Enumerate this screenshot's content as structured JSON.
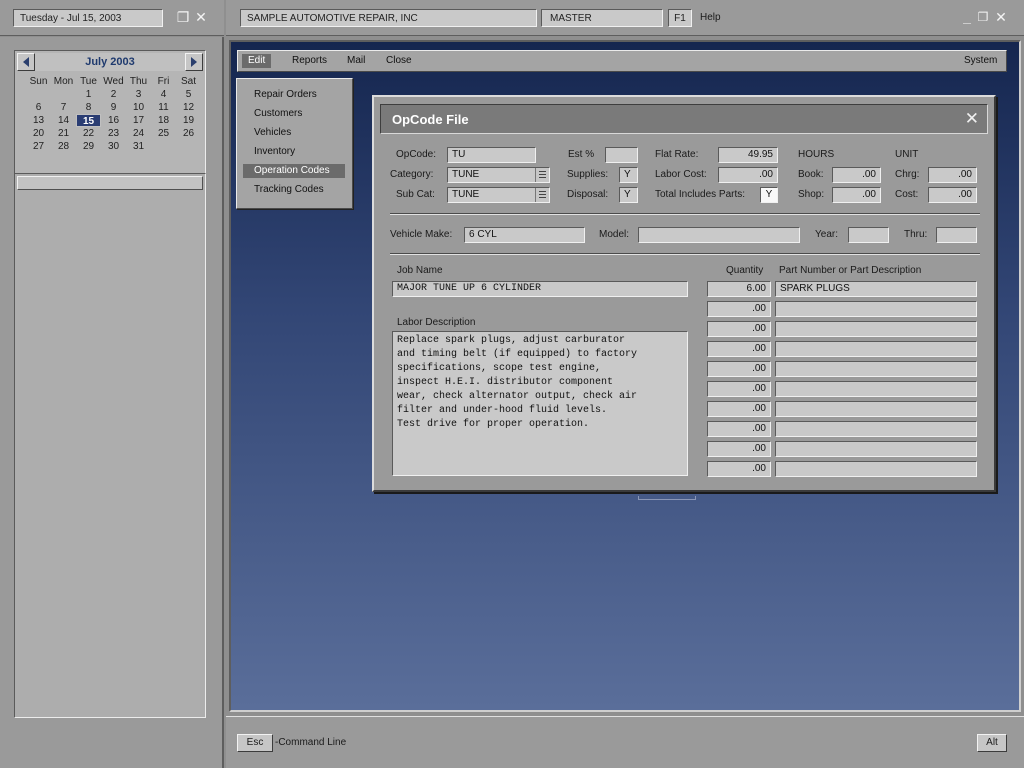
{
  "left_panel": {
    "date": "Tuesday - Jul 15, 2003",
    "restore_glyph": "❐",
    "close_glyph": "✕",
    "calendar": {
      "month": "July",
      "year": "2003",
      "weekdays": [
        "Sun",
        "Mon",
        "Tue",
        "Wed",
        "Thu",
        "Fri",
        "Sat"
      ],
      "leading_blanks": 2,
      "days_in_month": 31,
      "selected_day": 15
    }
  },
  "topbar": {
    "company": "SAMPLE AUTOMOTIVE REPAIR, INC",
    "master": "MASTER",
    "f1": "F1",
    "help": "Help",
    "minimize_glyph": "_",
    "maximize_glyph": "❐",
    "close_glyph": "✕"
  },
  "menubar": {
    "items": [
      "Edit",
      "Reports",
      "Mail",
      "Close"
    ],
    "active": "Edit",
    "system": "System"
  },
  "edit_menu": {
    "items": [
      "Repair Orders",
      "Customers",
      "Vehicles",
      "Inventory",
      "Operation Codes",
      "Tracking Codes"
    ],
    "active": "Operation Codes"
  },
  "dialog": {
    "title": "OpCode File",
    "close_glyph": "✕",
    "opcode": {
      "label": "OpCode:",
      "value": "TU"
    },
    "category": {
      "label": "Category:",
      "value": "TUNE"
    },
    "subcat": {
      "label": "Sub Cat:",
      "value": "TUNE"
    },
    "est_pct": {
      "label": "Est %",
      "value": ""
    },
    "supplies": {
      "label": "Supplies:",
      "value": "Y"
    },
    "disposal": {
      "label": "Disposal:",
      "value": "Y"
    },
    "flat_rate": {
      "label": "Flat Rate:",
      "value": "49.95"
    },
    "labor_cost": {
      "label": "Labor Cost:",
      "value": ".00"
    },
    "total_includes_parts": {
      "label": "Total Includes Parts:",
      "value": "Y"
    },
    "hours": {
      "header": "HOURS",
      "book_label": "Book:",
      "book": ".00",
      "shop_label": "Shop:",
      "shop": ".00"
    },
    "unit": {
      "header": "UNIT",
      "chrg_label": "Chrg:",
      "chrg": ".00",
      "cost_label": "Cost:",
      "cost": ".00"
    },
    "vehicle_make": {
      "label": "Vehicle Make:",
      "value": "6 CYL"
    },
    "model": {
      "label": "Model:",
      "value": ""
    },
    "year": {
      "label": "Year:",
      "value": ""
    },
    "thru": {
      "label": "Thru:",
      "value": ""
    },
    "job_name": {
      "label": "Job Name",
      "value": "MAJOR TUNE UP 6 CYLINDER"
    },
    "labor_description": {
      "label": "Labor Description",
      "lines": [
        "Replace spark plugs, adjust carburator",
        "and timing belt (if equipped) to factory",
        "specifications, scope test engine,",
        "inspect H.E.I. distributor component",
        "wear, check alternator output, check air",
        "filter and under-hood fluid levels.",
        "Test drive for proper operation."
      ]
    },
    "parts": {
      "quantity_header": "Quantity",
      "part_header": "Part Number or Part Description",
      "rows": [
        {
          "qty": "6.00",
          "part": "SPARK PLUGS"
        },
        {
          "qty": ".00",
          "part": ""
        },
        {
          "qty": ".00",
          "part": ""
        },
        {
          "qty": ".00",
          "part": ""
        },
        {
          "qty": ".00",
          "part": ""
        },
        {
          "qty": ".00",
          "part": ""
        },
        {
          "qty": ".00",
          "part": ""
        },
        {
          "qty": ".00",
          "part": ""
        },
        {
          "qty": ".00",
          "part": ""
        },
        {
          "qty": ".00",
          "part": ""
        }
      ]
    }
  },
  "bottombar": {
    "esc": "Esc",
    "command_line": "-Command Line",
    "alt": "Alt"
  }
}
